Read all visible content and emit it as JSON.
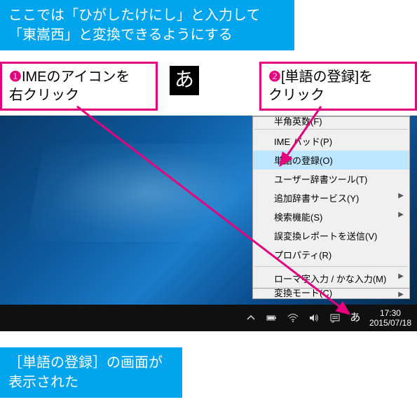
{
  "intro": {
    "line1": "ここでは「ひがしたけにし」と入力して",
    "line2": "「東嵩西」と変換できるようにする"
  },
  "step1": {
    "num": "❶",
    "line1": "IMEのアイコンを",
    "line2": "右クリック"
  },
  "step2": {
    "num": "❷",
    "line1": "[単語の登録]を",
    "line2": "クリック"
  },
  "ime_glyph": "あ",
  "menu": {
    "cut_top": "半角英数(F)",
    "items": [
      {
        "label": "IME パッド(P)",
        "sub": false,
        "hl": false
      },
      {
        "label": "単語の登録(O)",
        "sub": false,
        "hl": true
      },
      {
        "label": "ユーザー辞書ツール(T)",
        "sub": false,
        "hl": false
      },
      {
        "label": "追加辞書サービス(Y)",
        "sub": true,
        "hl": false
      },
      {
        "label": "検索機能(S)",
        "sub": true,
        "hl": false
      },
      {
        "label": "誤変換レポートを送信(V)",
        "sub": false,
        "hl": false
      },
      {
        "label": "プロパティ(R)",
        "sub": false,
        "hl": false
      }
    ],
    "items2": [
      {
        "label": "ローマ字入力 / かな入力(M)",
        "sub": true,
        "hl": false
      },
      {
        "label": "変換モード(C)",
        "sub": true,
        "hl": false,
        "cut": true
      }
    ]
  },
  "taskbar": {
    "time": "17:30",
    "date": "2015/07/18",
    "ime": "あ"
  },
  "result": {
    "line1": "［単語の登録］の画面が",
    "line2": "表示された"
  }
}
